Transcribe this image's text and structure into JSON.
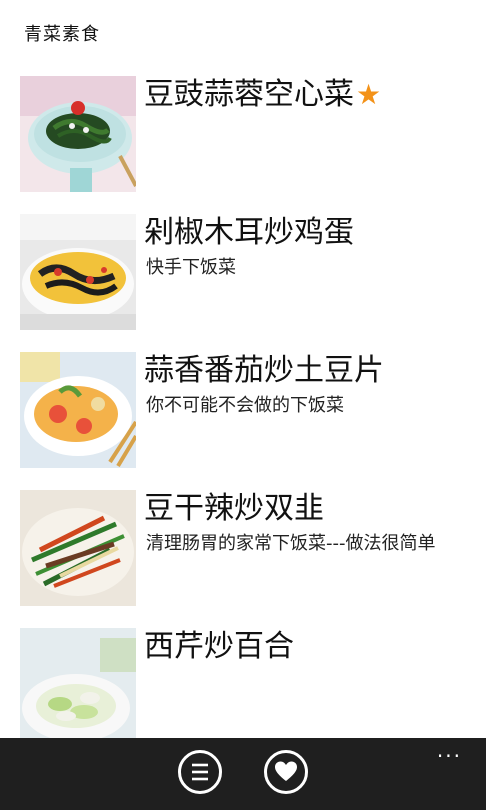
{
  "header": {
    "title": "青菜素食"
  },
  "items": [
    {
      "title": "豆豉蒜蓉空心菜",
      "subtitle": "",
      "favorite": true
    },
    {
      "title": "剁椒木耳炒鸡蛋",
      "subtitle": "快手下饭菜",
      "favorite": false
    },
    {
      "title": "蒜香番茄炒土豆片",
      "subtitle": "你不可能不会做的下饭菜",
      "favorite": false
    },
    {
      "title": "豆干辣炒双韭",
      "subtitle": "清理肠胃的家常下饭菜---做法很简单",
      "favorite": false
    },
    {
      "title": "西芹炒百合",
      "subtitle": "",
      "favorite": false
    }
  ],
  "appbar": {
    "list_icon": "list-icon",
    "heart_icon": "heart-icon",
    "more_label": "···"
  },
  "colors": {
    "star": "#f39219",
    "appbar": "#1f1f1f"
  }
}
